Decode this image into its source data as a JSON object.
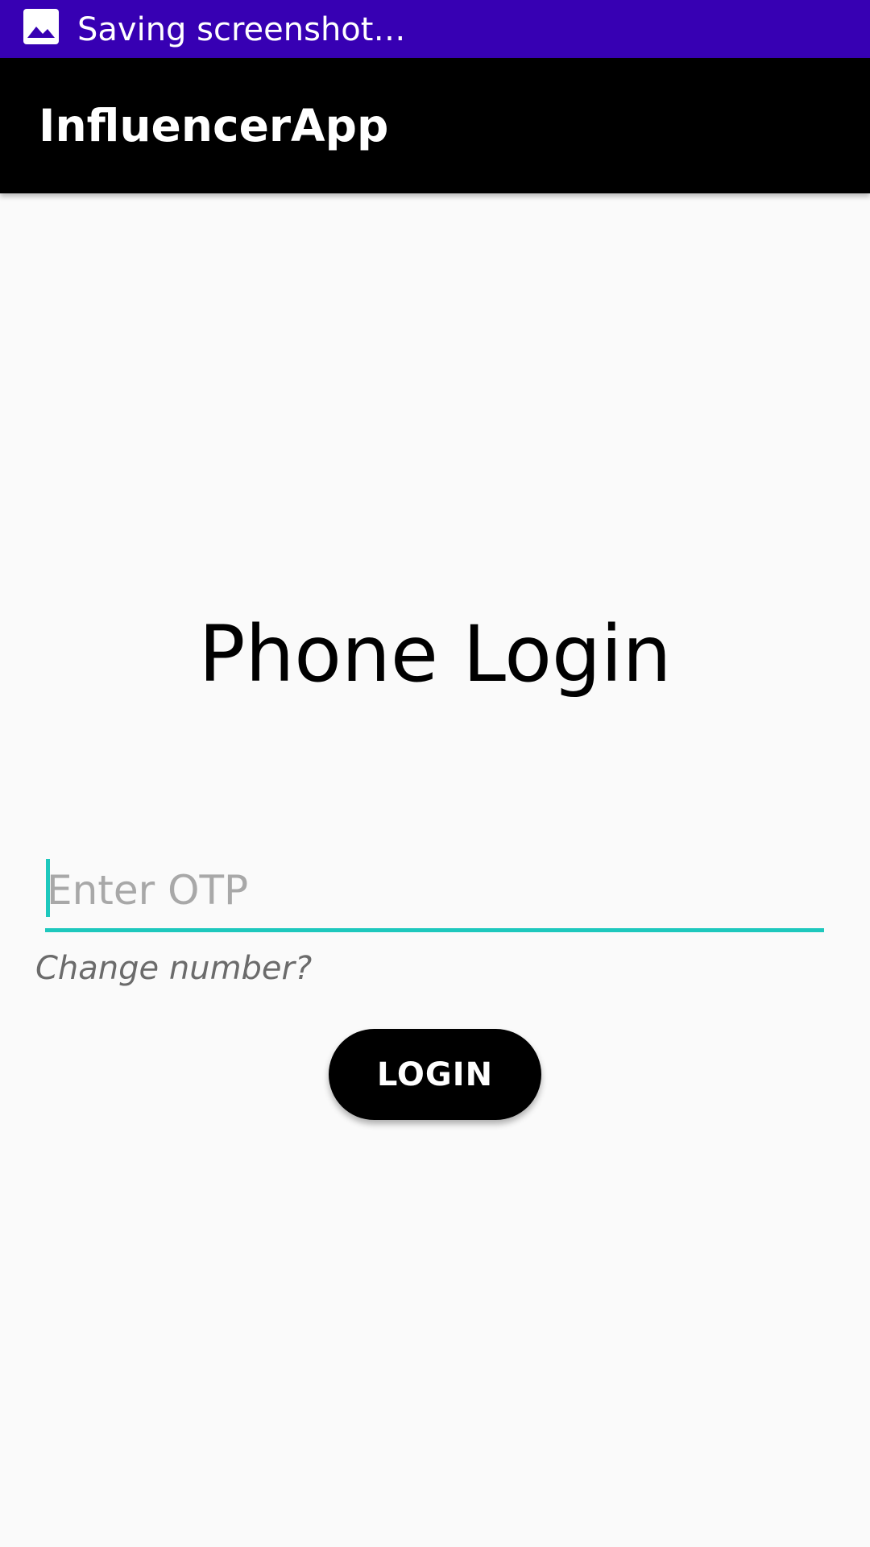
{
  "status_bar": {
    "icon": "image-icon",
    "text": "Saving screenshot…"
  },
  "app_bar": {
    "title": "InfluencerApp"
  },
  "main": {
    "title": "Phone Login",
    "otp_input": {
      "value": "",
      "placeholder": "Enter OTP"
    },
    "change_number_link": "Change number?",
    "login_button": "LOGIN"
  },
  "colors": {
    "status_bar": "#3700b3",
    "app_bar": "#000000",
    "accent": "#1ec8bd",
    "background": "#fafafa"
  }
}
